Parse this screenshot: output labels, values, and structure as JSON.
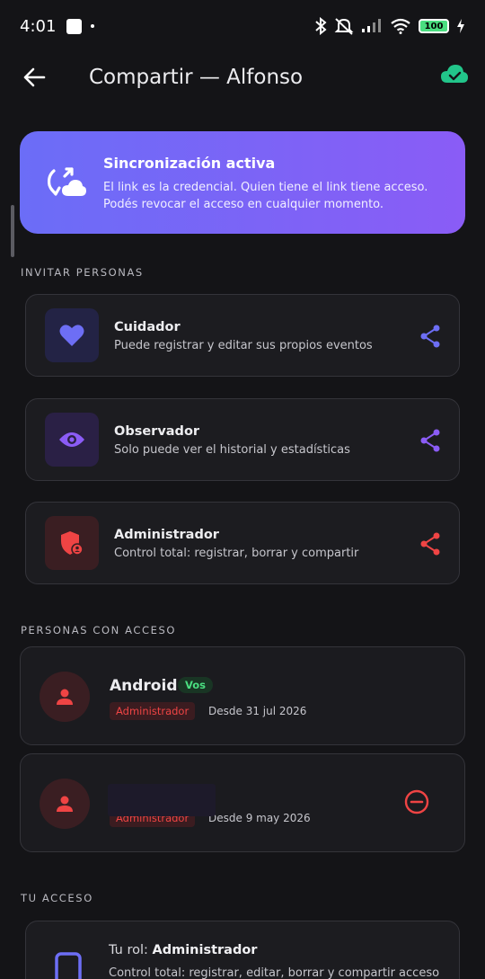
{
  "status_bar": {
    "time": "4:01",
    "battery": "100"
  },
  "app_bar": {
    "title": "Compartir — Alfonso"
  },
  "banner": {
    "title": "Sincronización activa",
    "line1": "El link es la credencial. Quien tiene el link tiene acceso.",
    "line2": "Podés revocar el acceso en cualquier momento."
  },
  "sections": {
    "invite": "INVITAR PERSONAS",
    "people": "PERSONAS CON ACCESO",
    "your_access": "TU ACCESO"
  },
  "invite_roles": [
    {
      "title": "Cuidador",
      "subtitle": "Puede registrar y editar sus propios eventos",
      "icon": "heart-icon",
      "color": "#6d6ef5"
    },
    {
      "title": "Observador",
      "subtitle": "Solo puede ver el historial y estadísticas",
      "icon": "eye-icon",
      "color": "#8b5cf6"
    },
    {
      "title": "Administrador",
      "subtitle": "Control total: registrar, borrar y compartir",
      "icon": "shield-icon",
      "color": "#ef4444"
    }
  ],
  "people": [
    {
      "name": "Android",
      "badge": "Vos",
      "role": "Administrador",
      "since": "Desde 31 jul 2026"
    },
    {
      "name": "",
      "role": "Administrador",
      "since": "Desde 9 may 2026"
    }
  ],
  "your_role": {
    "prefix": "Tu rol:",
    "role": "Administrador",
    "description": "Control total: registrar, editar, borrar y compartir acceso"
  }
}
